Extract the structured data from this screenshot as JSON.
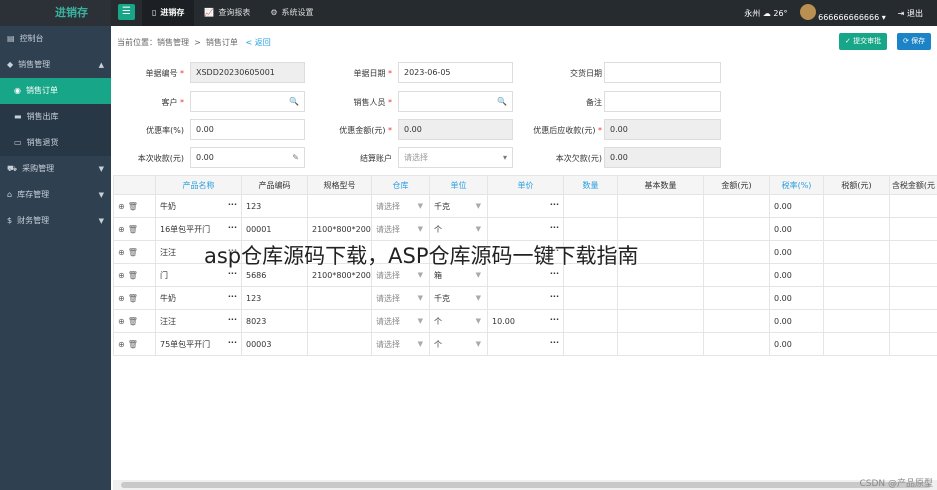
{
  "app": {
    "title": "进销存"
  },
  "topnav": [
    {
      "label": "进销存",
      "icon": "phone-icon",
      "active": true
    },
    {
      "label": "查询报表",
      "icon": "chart-icon",
      "active": false
    },
    {
      "label": "系统设置",
      "icon": "gear-icon",
      "active": false
    }
  ],
  "topright": {
    "city": "永州",
    "temp": "26°",
    "user": "666666666666",
    "logout": "退出"
  },
  "sidebar": {
    "dashboard": "控制台",
    "sales": "销售管理",
    "sales_order": "销售订单",
    "sales_out": "销售出库",
    "sales_return": "销售退货",
    "purchase": "采购管理",
    "inventory": "库存管理",
    "finance": "财务管理"
  },
  "breadcrumb": {
    "prefix": "当前位置：",
    "a": "销售管理",
    "sep": ">",
    "b": "销售订单",
    "back": "< 返回"
  },
  "buttons": {
    "submit": "提交审批",
    "save": "保存"
  },
  "form": {
    "doc_no_label": "单据编号",
    "doc_no": "XSDD20230605001",
    "doc_date_label": "单据日期",
    "doc_date": "2023-06-05",
    "deliver_date_label": "交货日期",
    "deliver_date": "",
    "customer_label": "客户",
    "customer": "",
    "salesperson_label": "销售人员",
    "salesperson": "",
    "remark_label": "备注",
    "remark": "",
    "discount_rate_label": "优惠率(%)",
    "discount_rate": "0.00",
    "discount_amount_label": "优惠金额(元)",
    "discount_amount": "0.00",
    "receivable_label": "优惠后应收款(元)",
    "receivable": "0.00",
    "received_label": "本次收款(元)",
    "received": "0.00",
    "account_label": "结算账户",
    "account_ph": "请选择",
    "owed_label": "本次欠款(元)",
    "owed": "0.00"
  },
  "table": {
    "headers": [
      "",
      "产品名称",
      "产品编码",
      "规格型号",
      "仓库",
      "单位",
      "单价",
      "数量",
      "基本数量",
      "金额(元)",
      "税率(%)",
      "税额(元)",
      "含税金额(元"
    ],
    "rows": [
      {
        "name": "牛奶",
        "code": "123",
        "spec": "",
        "wh": "请选择",
        "unit": "千克",
        "price": "",
        "tax": "0.00"
      },
      {
        "name": "16单包平开门",
        "code": "00001",
        "spec": "2100*800*200",
        "wh": "请选择",
        "unit": "个",
        "price": "",
        "tax": "0.00"
      },
      {
        "name": "汪汪",
        "code": "",
        "spec": "",
        "wh": "",
        "unit": "",
        "price": "",
        "tax": "0.00"
      },
      {
        "name": "门",
        "code": "5686",
        "spec": "2100*800*200",
        "wh": "请选择",
        "unit": "箱",
        "price": "",
        "tax": "0.00"
      },
      {
        "name": "牛奶",
        "code": "123",
        "spec": "",
        "wh": "请选择",
        "unit": "千克",
        "price": "",
        "tax": "0.00"
      },
      {
        "name": "汪汪",
        "code": "8023",
        "spec": "",
        "wh": "请选择",
        "unit": "个",
        "price": "10.00",
        "tax": "0.00"
      },
      {
        "name": "75单包平开门",
        "code": "00003",
        "spec": "",
        "wh": "请选择",
        "unit": "个",
        "price": "",
        "tax": "0.00"
      }
    ]
  },
  "overlay_text": "asp仓库源码下载，ASP仓库源码一键下载指南",
  "watermark": "CSDN @产品原型"
}
